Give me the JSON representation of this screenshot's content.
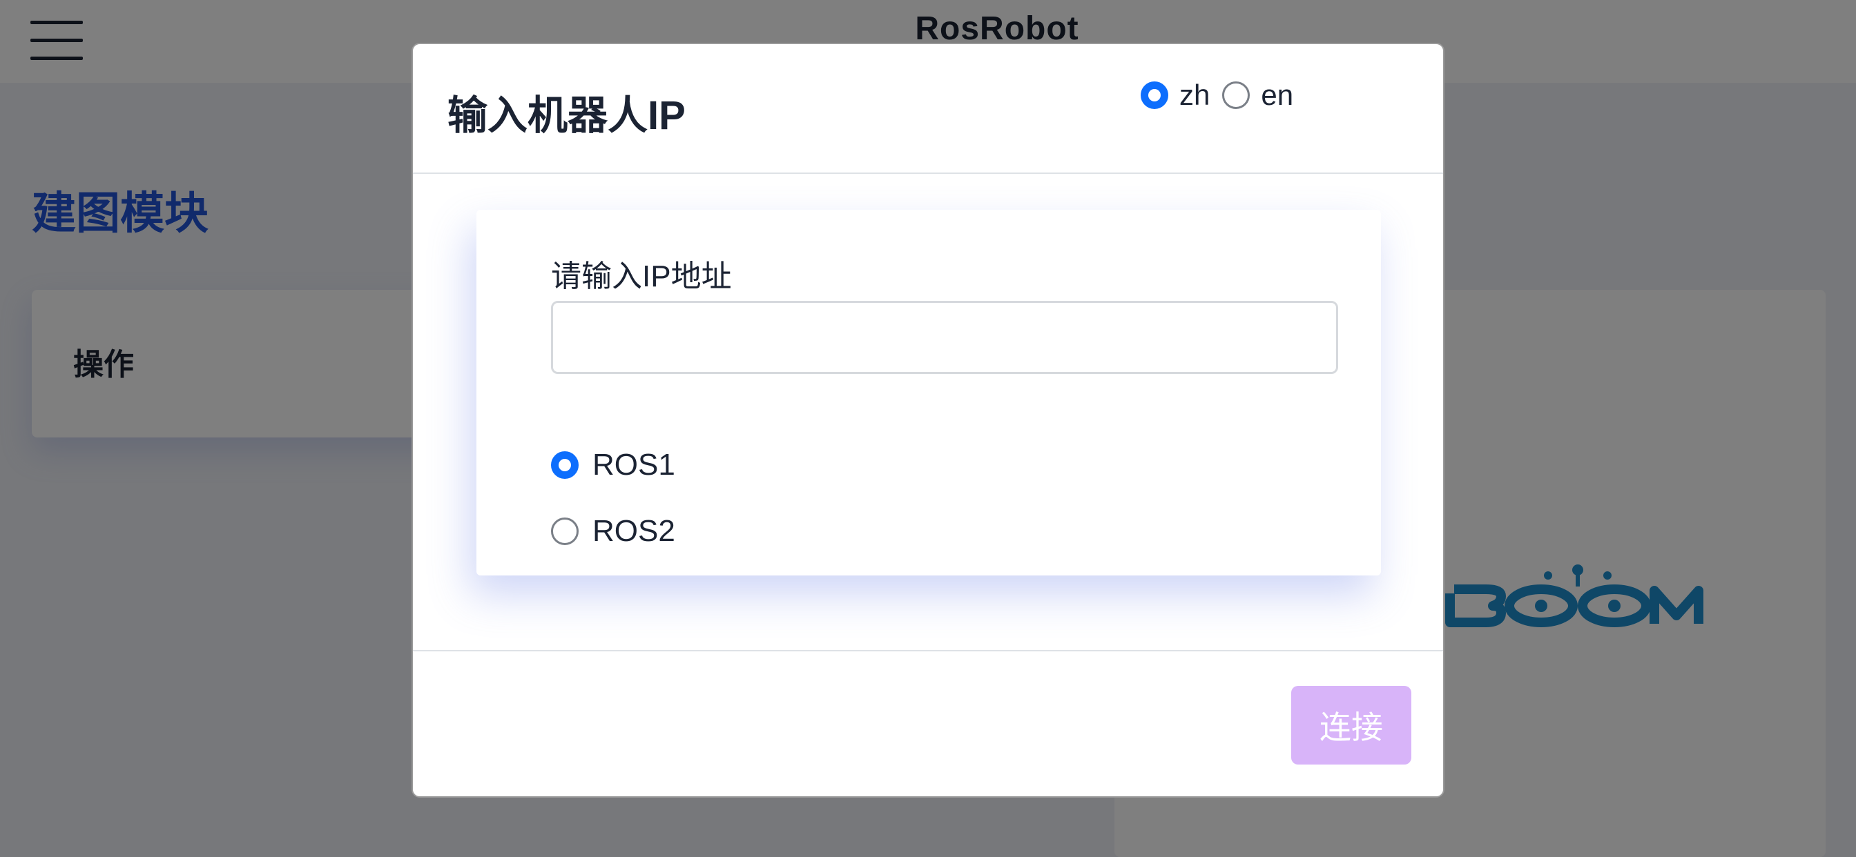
{
  "app": {
    "title": "RosRobot"
  },
  "page": {
    "module_title": "建图模块",
    "operations_title": "操作"
  },
  "modal": {
    "title": "输入机器人IP",
    "language_options": [
      {
        "label": "zh",
        "selected": true
      },
      {
        "label": "en",
        "selected": false
      }
    ],
    "ip_field": {
      "label": "请输入IP地址",
      "value": "",
      "placeholder": ""
    },
    "ros_options": [
      {
        "label": "ROS1",
        "selected": true
      },
      {
        "label": "ROS2",
        "selected": false
      }
    ],
    "connect_label": "连接"
  },
  "colors": {
    "accent": "#0d6efd",
    "module_title": "#2255d6",
    "connect_button": "#d8b4f9",
    "logo": "#1e8fce",
    "backdrop": "rgba(0,0,0,0.5)"
  },
  "icons": {
    "menu": "hamburger-icon",
    "logo": "yahboom-robot-logo"
  }
}
